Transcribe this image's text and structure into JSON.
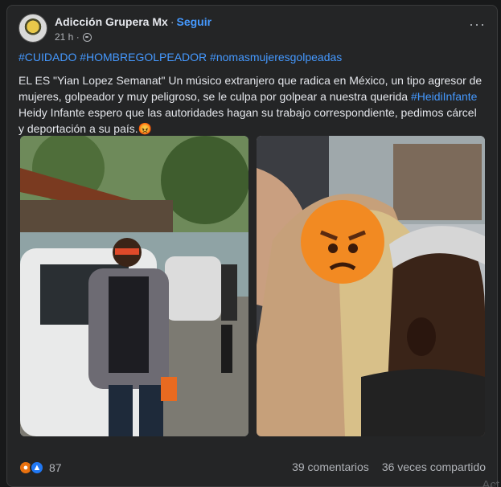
{
  "post": {
    "author": "Adicción Grupera Mx",
    "separator": "·",
    "follow_label": "Seguir",
    "time": "21 h ·",
    "more_label": "···",
    "hashtags": "#CUIDADO #HOMBREGOLPEADOR  #nomasmujeresgolpeadas",
    "body_part1": "EL ES \"Yian Lopez Semanat\" Un músico extranjero que radica en México, un tipo agresor de mujeres, golpeador y muy peligroso, se le culpa por golpear a nuestra querida ",
    "body_link": "#HeidiInfante",
    "body_part2": " Heidy Infante  espero que las autoridades hagan su trabajo correspondiente, pedimos cárcel y deportación a su país.",
    "body_emoji": "😡"
  },
  "footer": {
    "reaction_count": "87",
    "comments": "39 comentarios",
    "shares": "36 veces compartido"
  },
  "overlay": {
    "watermark": "Act"
  },
  "icons": {
    "angry": "angry-reaction-icon",
    "like": "like-reaction-icon",
    "globe": "globe-icon"
  },
  "colors": {
    "link": "#4599ff",
    "card": "#242526",
    "angry": "#e9710f",
    "like": "#2078f4"
  }
}
